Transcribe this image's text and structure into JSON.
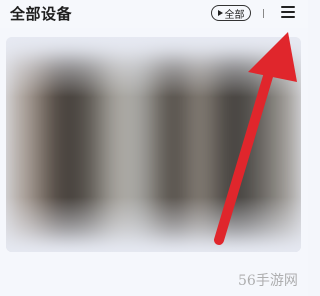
{
  "header": {
    "title": "全部设备",
    "filter_label": "全部"
  },
  "icons": {
    "filter": "play-triangle-icon",
    "menu": "hamburger-menu-icon"
  },
  "annotation": {
    "arrow_color": "#e0262c"
  },
  "watermark": {
    "text": "56手游网"
  }
}
